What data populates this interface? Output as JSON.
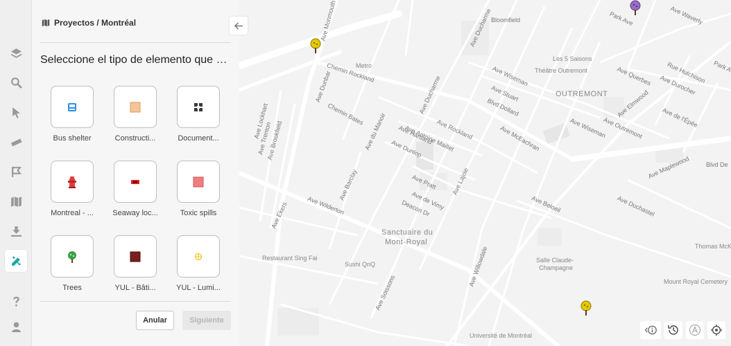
{
  "breadcrumb": {
    "label": "Proyectos / Montréal",
    "icon": "map-icon"
  },
  "panel": {
    "heading": "Seleccione el tipo de elemento que des...",
    "tiles": [
      {
        "label": "Bus shelter",
        "icon": "bus-shelter-icon",
        "color": "#2d8ee8"
      },
      {
        "label": "Constructi...",
        "icon": "construction-icon",
        "color": "#f4c59a"
      },
      {
        "label": "Document...",
        "icon": "document-icon",
        "color": "#3a3a3a"
      },
      {
        "label": "Montreal - ...",
        "icon": "fire-hydrant-icon",
        "color": "#e03c3c"
      },
      {
        "label": "Seaway loc...",
        "icon": "seaway-lock-icon",
        "color": "#d32020"
      },
      {
        "label": "Toxic spills",
        "icon": "toxic-spill-icon",
        "color": "#ef7f7f"
      },
      {
        "label": "Trees",
        "icon": "tree-icon",
        "color": "#3aa047"
      },
      {
        "label": "YUL - Bâti...",
        "icon": "building-icon",
        "color": "#7a1f1f"
      },
      {
        "label": "YUL - Lumi...",
        "icon": "light-icon",
        "color": "#f0c419"
      }
    ],
    "cancel_label": "Anular",
    "next_label": "Siguiente"
  },
  "rail": {
    "items": [
      {
        "icon": "layers-icon"
      },
      {
        "icon": "search-icon"
      },
      {
        "icon": "select-pointer-icon"
      },
      {
        "icon": "ruler-icon"
      },
      {
        "icon": "flag-icon"
      },
      {
        "icon": "map-icon"
      },
      {
        "icon": "download-icon"
      },
      {
        "icon": "edit-tools-icon",
        "active": true
      },
      {
        "icon": "help-icon"
      },
      {
        "icon": "user-icon"
      }
    ]
  },
  "map": {
    "labels": {
      "bloomfield": "Bloomfield",
      "les5saisons": "Les 5 Saisons",
      "theatre": "Théâtre Outremont",
      "outremont": "OUTREMONT",
      "metro": "Metro",
      "chemin_rockland": "Chemin Rockland",
      "chemin_bates": "Chemin Bates",
      "sanctuaire": "Sanctuaire du",
      "mont_royal": "Mont-Royal",
      "restaurant": "Restaurant Sing Fai",
      "sushi": "Sushi QnQ",
      "salle1": "Salle Claude-",
      "salle2": "Champagne",
      "mount_royal_cemetery": "Mount Royal Cemetery",
      "thomas": "Thomas McKa",
      "universite": "Université de Montréal",
      "blvd_dollard": "Blvd Dollard",
      "ave_wiseman": "Ave Wiseman",
      "ave_stuart": "Ave Stuart",
      "ave_rockland": "Ave Rockland",
      "ave_antoine_maillet": "Ave Antoine Maillet",
      "ave_hartland": "Ave Hartland",
      "ave_dunlop": "Ave Dunlop",
      "ave_mceachran": "Ave McEachran",
      "ave_wilderton": "Ave Wilderton",
      "ave_beloeil": "Ave Beloeil",
      "ave_duchastel": "Ave Duchastel",
      "ave_maplewood": "Ave Maplewood",
      "blvd_de": "Blvd De",
      "park_ave": "Park Ave",
      "ave_waverly": "Ave Waverly",
      "rue_hutchison": "Rue Hutchison",
      "ave_durocher": "Ave Durocher",
      "ave_querbes": "Ave Querbes",
      "ave_elmwood": "Ave Elmwood",
      "ave_outremont": "Ave Outremont",
      "ave_de_lepee": "Ave de l'Épée",
      "ave_pratt": "Ave Pratt",
      "ave_de_vimy": "Ave de Vimy",
      "deacon_dr": "Deacon Dr",
      "ave_lajoie": "Ave Lajoie",
      "ave_barclay": "Ave Barclay",
      "ave_ekers": "Ave Ekers",
      "ave_lockhart": "Ave Lockhart",
      "ave_trenton": "Ave Trenton",
      "ave_brookfield": "Ave Brookfield",
      "ave_dunbar": "Ave Dunbar",
      "ave_du_manoir": "Ave du Manoir",
      "ave_ducharme": "Ave Ducharme",
      "ave_willowdale": "Ave Willowdale",
      "ave_soissons": "Ave Soissons",
      "ave_monmouth": "Ave Monmouth"
    },
    "markers": [
      {
        "icon": "tree-marker-icon",
        "color": "#d4b800"
      },
      {
        "icon": "tree-marker-icon",
        "color": "#d4b800"
      },
      {
        "icon": "tree-marker-icon",
        "color": "#8a5bb5"
      }
    ],
    "controls": [
      "info-icon",
      "history-icon",
      "auto-icon",
      "locate-icon"
    ]
  }
}
